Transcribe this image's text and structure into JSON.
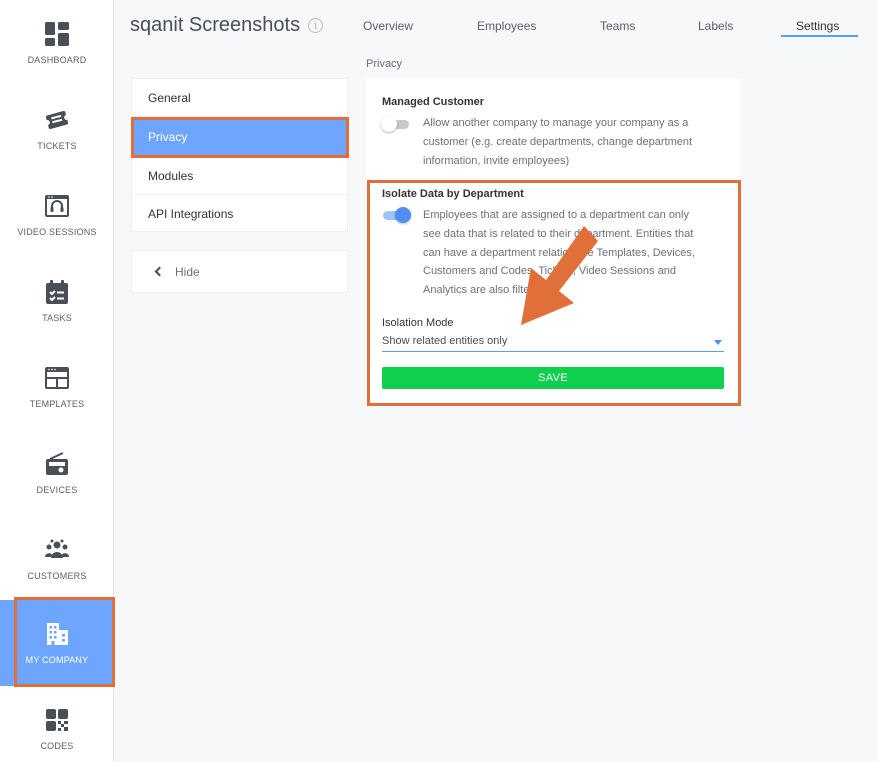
{
  "sidebar": {
    "items": [
      {
        "label": "DASHBOARD",
        "icon": "dashboard-icon"
      },
      {
        "label": "TICKETS",
        "icon": "ticket-icon"
      },
      {
        "label": "VIDEO SESSIONS",
        "icon": "headset-icon"
      },
      {
        "label": "TASKS",
        "icon": "calendar-check-icon"
      },
      {
        "label": "TEMPLATES",
        "icon": "template-icon"
      },
      {
        "label": "DEVICES",
        "icon": "radio-device-icon"
      },
      {
        "label": "CUSTOMERS",
        "icon": "users-icon"
      },
      {
        "label": "MY COMPANY",
        "icon": "building-icon",
        "active": true
      },
      {
        "label": "CODES",
        "icon": "qr-code-icon"
      }
    ]
  },
  "header": {
    "title": "sqanit Screenshots",
    "info_icon": "i",
    "tabs": [
      {
        "label": "Overview"
      },
      {
        "label": "Employees"
      },
      {
        "label": "Teams"
      },
      {
        "label": "Labels"
      },
      {
        "label": "Settings",
        "active": true
      }
    ]
  },
  "settings_menu": {
    "items": [
      {
        "label": "General"
      },
      {
        "label": "Privacy",
        "active": true
      },
      {
        "label": "Modules"
      },
      {
        "label": "API Integrations"
      }
    ],
    "hide_label": "Hide"
  },
  "privacy": {
    "section_label": "Privacy",
    "managed_customer": {
      "title": "Managed Customer",
      "enabled": false,
      "description": "Allow another company to manage your company as a customer (e.g. create departments, change department information, invite employees)"
    },
    "isolate_data": {
      "title": "Isolate Data by Department",
      "enabled": true,
      "description": "Employees that are assigned to a department can only see data that is related to their department. Entities that can have a department relation are Templates, Devices, Customers and Codes. Tickets, Video Sessions and Analytics are also filtered."
    },
    "isolation_mode": {
      "label": "Isolation Mode",
      "selected": "Show related entities only"
    },
    "save_label": "SAVE"
  },
  "colors": {
    "accent": "#6ea6ff",
    "highlight": "#e06f3a",
    "save": "#0fcf4f",
    "toggle_on": "#4f8ff0"
  }
}
